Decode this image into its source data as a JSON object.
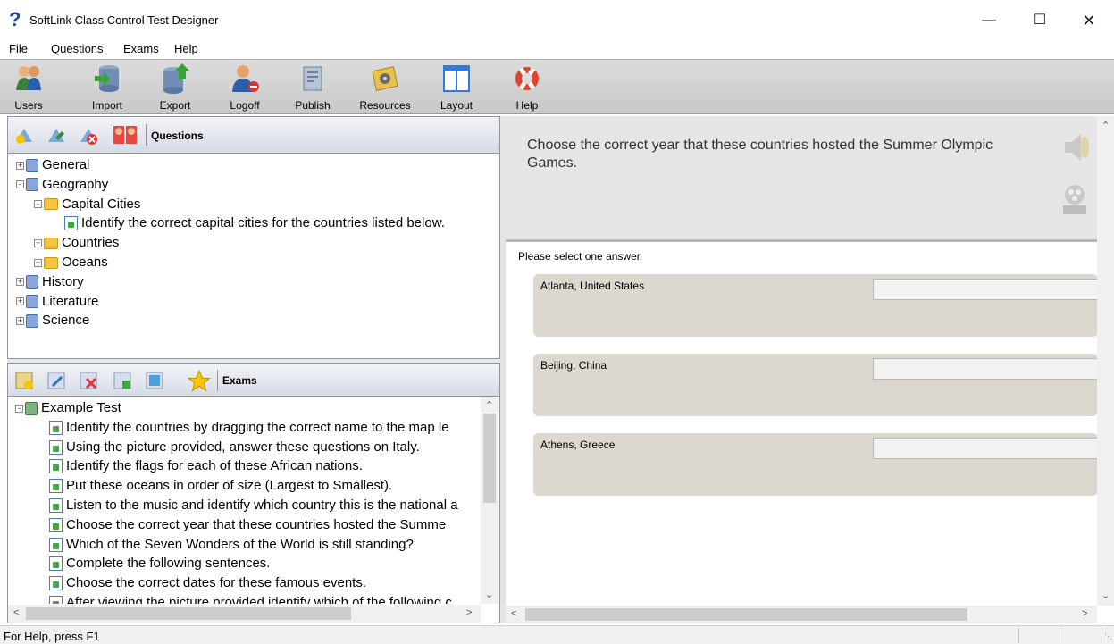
{
  "window": {
    "title": "SoftLink Class Control Test Designer",
    "icon": "question-mark-icon"
  },
  "menu": [
    "File",
    "Questions",
    "Exams",
    "Help"
  ],
  "toolbar": [
    {
      "label": "Users",
      "icon": "users-icon"
    },
    {
      "label": "Import",
      "icon": "import-database-icon"
    },
    {
      "label": "Export",
      "icon": "export-database-icon"
    },
    {
      "label": "Logoff",
      "icon": "logoff-user-icon"
    },
    {
      "label": "Publish",
      "icon": "publish-icon"
    },
    {
      "label": "Resources",
      "icon": "resources-film-icon"
    },
    {
      "label": "Layout",
      "icon": "layout-icon"
    },
    {
      "label": "Help",
      "icon": "lifebuoy-help-icon"
    }
  ],
  "questions_panel": {
    "title": "Questions",
    "tree": [
      {
        "label": "General",
        "kind": "book",
        "state": "collapsed"
      },
      {
        "label": "Geography",
        "kind": "book",
        "state": "expanded"
      },
      {
        "label": "Capital Cities",
        "kind": "folder",
        "state": "expanded"
      },
      {
        "label": "Identify the correct capital cities for the countries listed below.",
        "kind": "question"
      },
      {
        "label": "Countries",
        "kind": "folder",
        "state": "collapsed"
      },
      {
        "label": "Oceans",
        "kind": "folder",
        "state": "collapsed"
      },
      {
        "label": "History",
        "kind": "book",
        "state": "collapsed"
      },
      {
        "label": "Literature",
        "kind": "book",
        "state": "collapsed"
      },
      {
        "label": "Science",
        "kind": "book",
        "state": "collapsed"
      }
    ]
  },
  "exams_panel": {
    "title": "Exams",
    "exam_name": "Example Test",
    "questions": [
      "Identify the countries by dragging the correct name to the map le",
      "Using the picture provided, answer these questions on Italy.",
      "Identify the flags for each of these African nations.",
      "Put these oceans in order of size (Largest to Smallest).",
      "Listen to the music and identify which country this is the national a",
      "Choose the correct year that these countries hosted the Summe",
      "Which of the Seven Wonders of the World is still standing?",
      "Complete the following sentences.",
      "Choose the correct dates for these famous events.",
      "After viewing the picture provided identify which of the following c"
    ]
  },
  "question_view": {
    "question": "Choose the correct year that these countries hosted the Summer Olympic Games.",
    "instruction": "Please select one answer",
    "answers": [
      "Atlanta, United States",
      "Beijing, China",
      "Athens, Greece"
    ]
  },
  "status": {
    "text": "For Help, press F1"
  }
}
